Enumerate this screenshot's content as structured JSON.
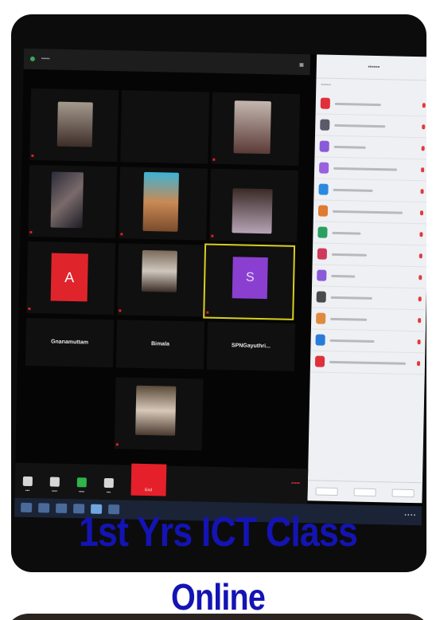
{
  "caption": {
    "line1": "1st Yrs ICT Class",
    "line2": "Online"
  },
  "colors": {
    "caption": "#1414b4",
    "end_button": "#e5202b",
    "active_speaker_border": "#d9d01c",
    "avatar_a": "#e0242b",
    "avatar_s": "#8b3fd1"
  },
  "gallery": {
    "avatar_a_letter": "A",
    "avatar_s_letter": "S",
    "bottom_names": [
      "Gnanamuttam",
      "Bimala",
      "SPNGayuthri..."
    ]
  },
  "toolbar": {
    "end_label": "End"
  },
  "icons": [
    "mute-icon",
    "video-icon",
    "participants-icon",
    "share-screen-icon",
    "record-icon",
    "end-call-icon"
  ]
}
